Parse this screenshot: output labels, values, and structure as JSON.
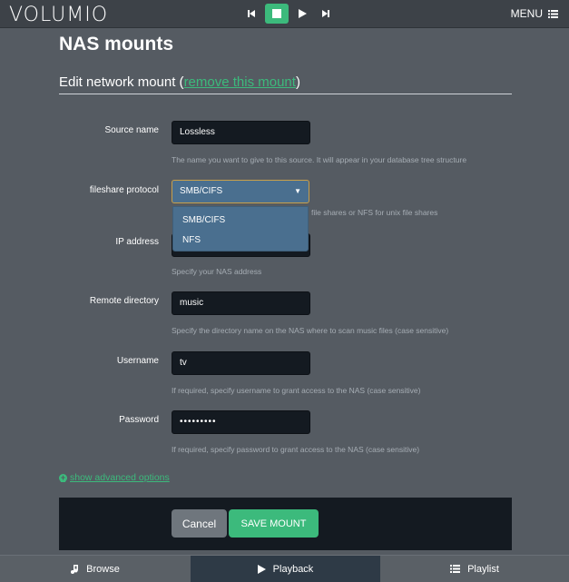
{
  "topbar": {
    "logo": "VOLUMIO",
    "menu_label": "MENU"
  },
  "page": {
    "title": "NAS mounts",
    "section_prefix": "Edit network mount (",
    "section_link": "remove this mount",
    "section_suffix": ")"
  },
  "form": {
    "source_name": {
      "label": "Source name",
      "value": "Lossless",
      "help": "The name you want to give to this source. It will appear in your database tree structure"
    },
    "protocol": {
      "label": "fileshare protocol",
      "value": "SMB/CIFS",
      "options": [
        "SMB/CIFS",
        "NFS"
      ],
      "help_visible": "file shares or NFS for unix file shares"
    },
    "ip_address": {
      "label": "IP address",
      "value": "",
      "help": "Specify your NAS address"
    },
    "remote_directory": {
      "label": "Remote directory",
      "value": "music",
      "help": "Specify the directory name on the NAS where to scan music files (case sensitive)"
    },
    "username": {
      "label": "Username",
      "value": "tv",
      "help": "If required, specify username to grant access to the NAS (case sensitive)"
    },
    "password": {
      "label": "Password",
      "value": "•••••••••",
      "help": "If required, specify password to grant access to the NAS (case sensitive)"
    }
  },
  "advanced_link": "show advanced options",
  "buttons": {
    "cancel": "Cancel",
    "save": "SAVE MOUNT"
  },
  "bottomnav": {
    "browse": "Browse",
    "playback": "Playback",
    "playlist": "Playlist"
  },
  "colors": {
    "accent": "#3cba7c",
    "background": "#555b62",
    "panel": "#141a21",
    "select": "#4a6f8f"
  }
}
